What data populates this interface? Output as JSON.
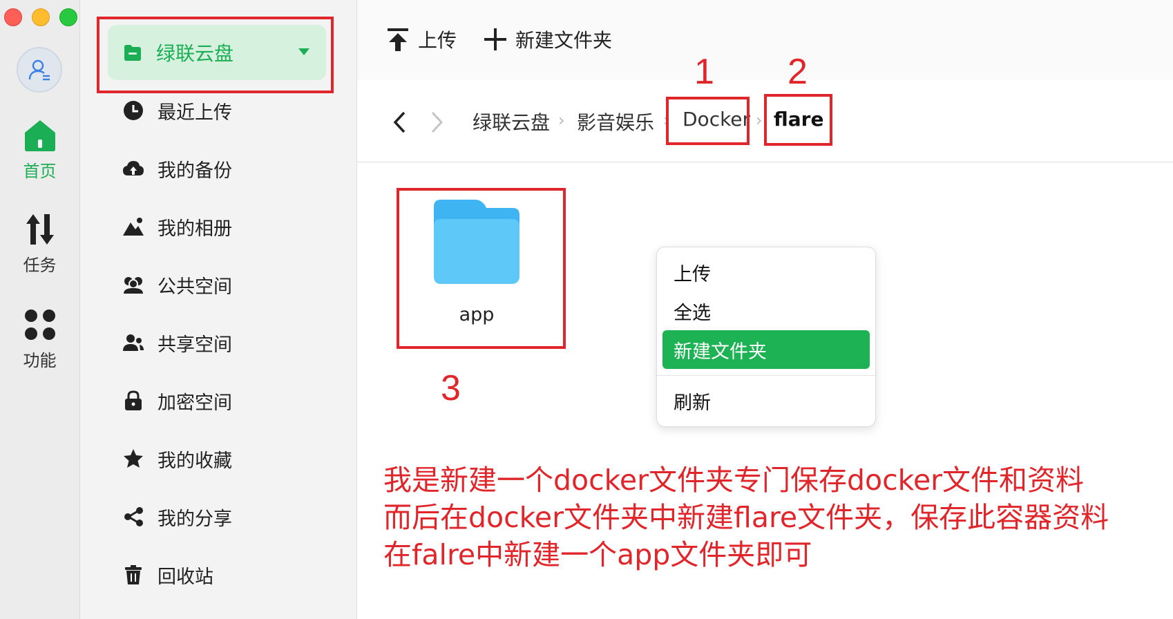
{
  "rail": {
    "items": [
      {
        "label": "首页",
        "icon": "home-icon",
        "active": true
      },
      {
        "label": "任务",
        "icon": "transfer-icon",
        "active": false
      },
      {
        "label": "功能",
        "icon": "apps-grid-icon",
        "active": false
      }
    ]
  },
  "sidebar": {
    "drive": {
      "label": "绿联云盘",
      "icon": "cloud-drive-icon"
    },
    "items": [
      {
        "label": "最近上传",
        "icon": "clock-icon"
      },
      {
        "label": "我的备份",
        "icon": "cloud-backup-icon"
      },
      {
        "label": "我的相册",
        "icon": "photo-icon"
      },
      {
        "label": "公共空间",
        "icon": "group-icon"
      },
      {
        "label": "共享空间",
        "icon": "share-users-icon"
      },
      {
        "label": "加密空间",
        "icon": "lock-icon"
      },
      {
        "label": "我的收藏",
        "icon": "star-icon"
      },
      {
        "label": "我的分享",
        "icon": "share-icon"
      },
      {
        "label": "回收站",
        "icon": "trash-icon"
      }
    ]
  },
  "toolbar": {
    "upload_label": "上传",
    "new_folder_label": "新建文件夹"
  },
  "breadcrumb": [
    "绿联云盘",
    "影音娱乐",
    "Docker",
    "flare"
  ],
  "files": [
    {
      "name": "app",
      "type": "folder"
    }
  ],
  "context_menu": {
    "items": [
      "上传",
      "全选",
      "新建文件夹",
      "刷新"
    ],
    "selected": "新建文件夹"
  },
  "annotations": {
    "markers": [
      "1",
      "2",
      "3"
    ],
    "note_lines": [
      "我是新建一个docker文件夹专门保存docker文件和资料",
      "而后在docker文件夹中新建flare文件夹，保存此容器资料",
      "在falre中新建一个app文件夹即可"
    ]
  },
  "colors": {
    "accent": "#1bae55",
    "annotation": "#e0262b",
    "folder": "#5ec8f8"
  }
}
